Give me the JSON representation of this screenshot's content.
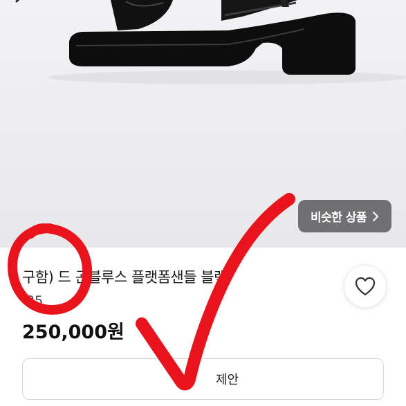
{
  "product": {
    "title": "구함) 드   곤블루스 플랫폼샌들 블랙",
    "subinfo": "·35",
    "price": "250,000원"
  },
  "similar_button": {
    "label": "비슷한 상품",
    "icon": "chevron-right-icon"
  },
  "offer_button": {
    "label": "제안"
  },
  "icons": {
    "back": "chevron-left-icon",
    "heart": "heart-icon"
  },
  "colors": {
    "annotation": "#e8131b",
    "similar_bg": "#5f5f61"
  }
}
